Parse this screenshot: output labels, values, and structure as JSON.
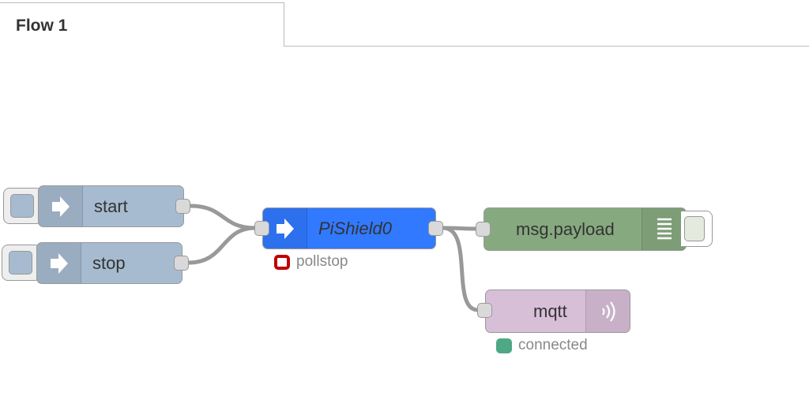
{
  "tab": {
    "title": "Flow 1"
  },
  "nodes": {
    "start": {
      "label": "start",
      "icon": "arrow-right-icon",
      "color": "#a6bbcf"
    },
    "stop": {
      "label": "stop",
      "icon": "arrow-right-icon",
      "color": "#a6bbcf"
    },
    "pishield": {
      "label": "PiShield0",
      "icon": "arrow-right-icon",
      "color": "#3179ff",
      "status": "pollstop",
      "status_color": "#c00000"
    },
    "debug": {
      "label": "msg.payload",
      "icon": "list-icon",
      "color": "#87a980"
    },
    "mqtt": {
      "label": "mqtt",
      "icon": "radio-waves-icon",
      "color": "#d8bfd8",
      "status": "connected",
      "status_color": "#4ea885"
    }
  }
}
